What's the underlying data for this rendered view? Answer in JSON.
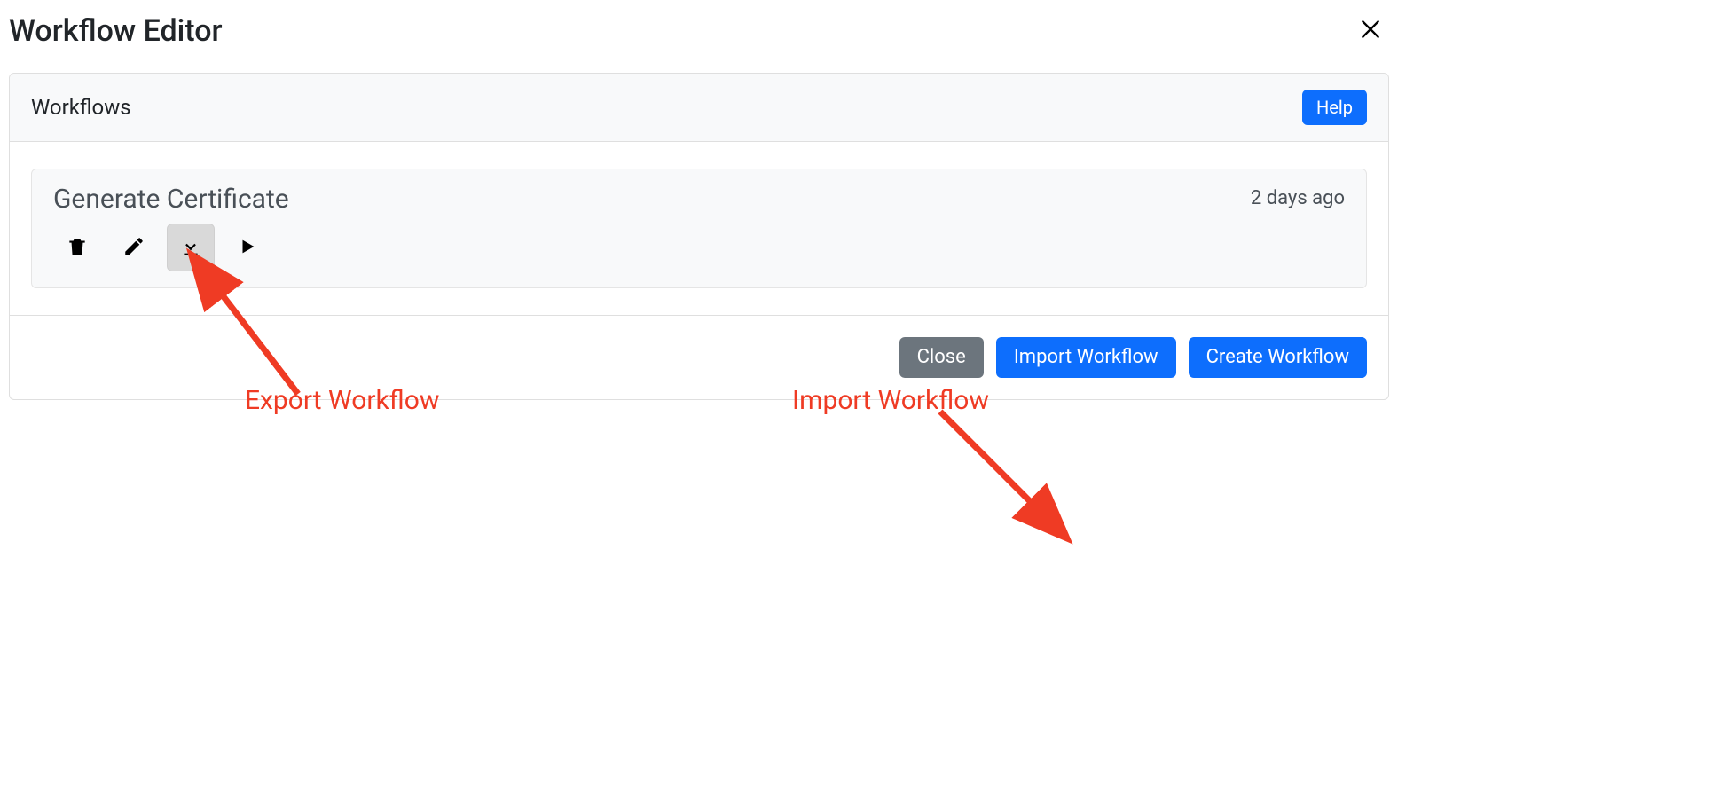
{
  "modal": {
    "title": "Workflow Editor"
  },
  "panel": {
    "header_title": "Workflows",
    "help_label": "Help"
  },
  "item": {
    "name": "Generate Certificate",
    "time": "2 days ago"
  },
  "footer": {
    "close": "Close",
    "import": "Import Workflow",
    "create": "Create Workflow"
  },
  "annotations": {
    "export": "Export Workflow",
    "import": "Import Workflow"
  }
}
